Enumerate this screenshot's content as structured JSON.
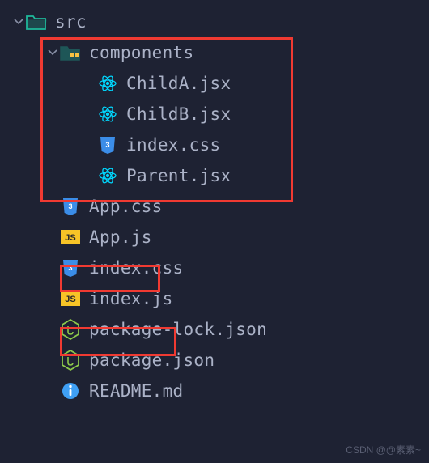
{
  "tree": {
    "root": {
      "name": "src",
      "icon": "folder-open",
      "expanded": true
    },
    "components_folder": {
      "name": "components",
      "icon": "folder-components",
      "expanded": true
    },
    "components_children": [
      {
        "name": "ChildA.jsx",
        "icon": "react"
      },
      {
        "name": "ChildB.jsx",
        "icon": "react"
      },
      {
        "name": "index.css",
        "icon": "css"
      },
      {
        "name": "Parent.jsx",
        "icon": "react"
      }
    ],
    "root_files": [
      {
        "name": "App.css",
        "icon": "css"
      },
      {
        "name": "App.js",
        "icon": "js"
      },
      {
        "name": "index.css",
        "icon": "css"
      },
      {
        "name": "index.js",
        "icon": "js"
      },
      {
        "name": "package-lock.json",
        "icon": "node"
      },
      {
        "name": "package.json",
        "icon": "node"
      },
      {
        "name": "README.md",
        "icon": "info"
      }
    ]
  },
  "watermark": "CSDN @@素素~",
  "colors": {
    "bg": "#1e2233",
    "text": "#abb2c7",
    "folder": "#1fb89a",
    "react": "#00d8ff",
    "css": "#3b8de8",
    "js_bg": "#f7c427",
    "js_text": "#2b2b2b",
    "node": "#8cc84b",
    "info": "#3fa0f5",
    "highlight": "#f03a32"
  }
}
